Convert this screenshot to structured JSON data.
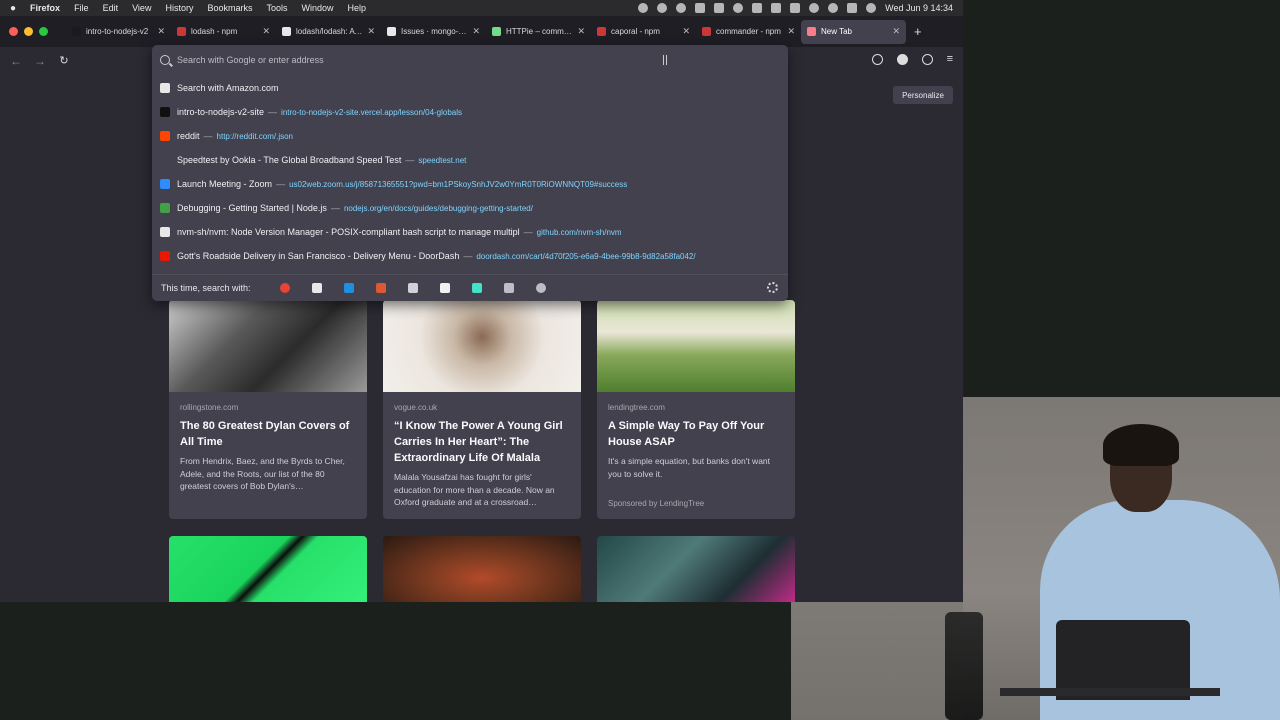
{
  "menubar": {
    "app": "Firefox",
    "items": [
      "File",
      "Edit",
      "View",
      "History",
      "Bookmarks",
      "Tools",
      "Window",
      "Help"
    ],
    "clock": "Wed Jun 9  14:34"
  },
  "tabs": [
    {
      "title": "intro-to-nodejs-v2",
      "color": "#1b1b1b"
    },
    {
      "title": "lodash - npm",
      "color": "#cb3837"
    },
    {
      "title": "lodash/lodash: A mo",
      "color": "#e8e8e8"
    },
    {
      "title": "Issues · mongo-exp",
      "color": "#e8e8e8"
    },
    {
      "title": "HTTPie – command",
      "color": "#73dc8c"
    },
    {
      "title": "caporal - npm",
      "color": "#cb3837"
    },
    {
      "title": "commander - npm",
      "color": "#cb3837"
    },
    {
      "title": "New Tab",
      "color": "#ff7b8a"
    }
  ],
  "urlbar": {
    "placeholder": "Search with Google or enter address",
    "results": [
      {
        "title": "Search with Amazon.com",
        "url": "",
        "icon_color": "#e8e8e8"
      },
      {
        "title": "intro-to-nodejs-v2-site",
        "url": "intro-to-nodejs-v2-site.vercel.app/lesson/04-globals",
        "icon_color": "#111111"
      },
      {
        "title": "reddit",
        "url": "http://reddit.com/.json",
        "icon_color": "#ff4500"
      },
      {
        "title": "Speedtest by Ookla - The Global Broadband Speed Test",
        "url": "speedtest.net",
        "icon_color": "#42414d"
      },
      {
        "title": "Launch Meeting - Zoom",
        "url": "us02web.zoom.us/j/85871365551?pwd=bm1PSkoySnhJV2w0YmR0T0RiOWNNQT09#success",
        "icon_color": "#2d8cff"
      },
      {
        "title": "Debugging - Getting Started | Node.js",
        "url": "nodejs.org/en/docs/guides/debugging-getting-started/",
        "icon_color": "#43a047"
      },
      {
        "title": "nvm-sh/nvm: Node Version Manager - POSIX-compliant bash script to manage multipl",
        "url": "github.com/nvm-sh/nvm",
        "icon_color": "#e8e8e8"
      },
      {
        "title": "Gott's Roadside Delivery in San Francisco - Delivery Menu - DoorDash",
        "url": "doordash.com/cart/4d70f205-e6a9-4bee-99b8-9d82a58fa042/",
        "icon_color": "#eb1700"
      }
    ],
    "search_with_label": "This time, search with:",
    "engines": [
      {
        "name": "google-icon",
        "color": "#ea4335"
      },
      {
        "name": "amazon-icon",
        "color": "#e8e8e8"
      },
      {
        "name": "bing-icon",
        "color": "#1f8fe0"
      },
      {
        "name": "duckduckgo-icon",
        "color": "#de5833"
      },
      {
        "name": "ebay-icon",
        "color": "#d0d0d8"
      },
      {
        "name": "wikipedia-icon",
        "color": "#f0f0f0"
      },
      {
        "name": "bookmarks-star-icon",
        "color": "#45e0c8"
      },
      {
        "name": "tabs-icon",
        "color": "#bdbdc6"
      },
      {
        "name": "history-icon",
        "color": "#bdbdc6"
      }
    ]
  },
  "personalize": "Personalize",
  "cards": [
    {
      "source": "rollingstone.com",
      "headline": "The 80 Greatest Dylan Covers of All Time",
      "desc": "From Hendrix, Baez, and the Byrds to Cher, Adele, and the Roots, our list of the 80 greatest covers of Bob Dylan's…",
      "sponsored": ""
    },
    {
      "source": "vogue.co.uk",
      "headline": "“I Know The Power A Young Girl Carries In Her Heart”: The Extraordinary Life Of Malala",
      "desc": "Malala Yousafzai has fought for girls' education for more than a decade. Now an Oxford graduate and at a crossroad…",
      "sponsored": ""
    },
    {
      "source": "lendingtree.com",
      "headline": "A Simple Way To Pay Off Your House ASAP",
      "desc": "It's a simple equation, but banks don't want you to solve it.",
      "sponsored": "Sponsored by LendingTree"
    }
  ]
}
